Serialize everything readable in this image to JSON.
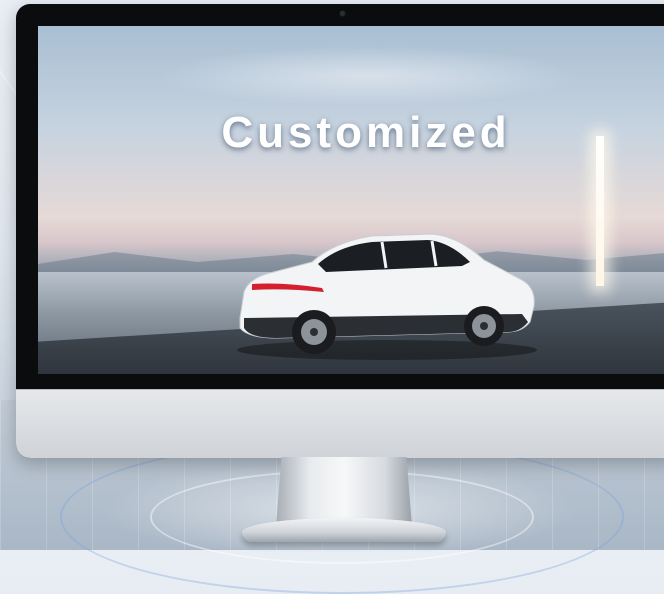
{
  "screen": {
    "headline": "Customized"
  },
  "icons": {
    "camera": "camera-dot",
    "car": "electric-suv-illustration"
  },
  "colors": {
    "bezel": "#0b0c0e",
    "chin": "#d9dde1",
    "headline": "#ffffff"
  }
}
